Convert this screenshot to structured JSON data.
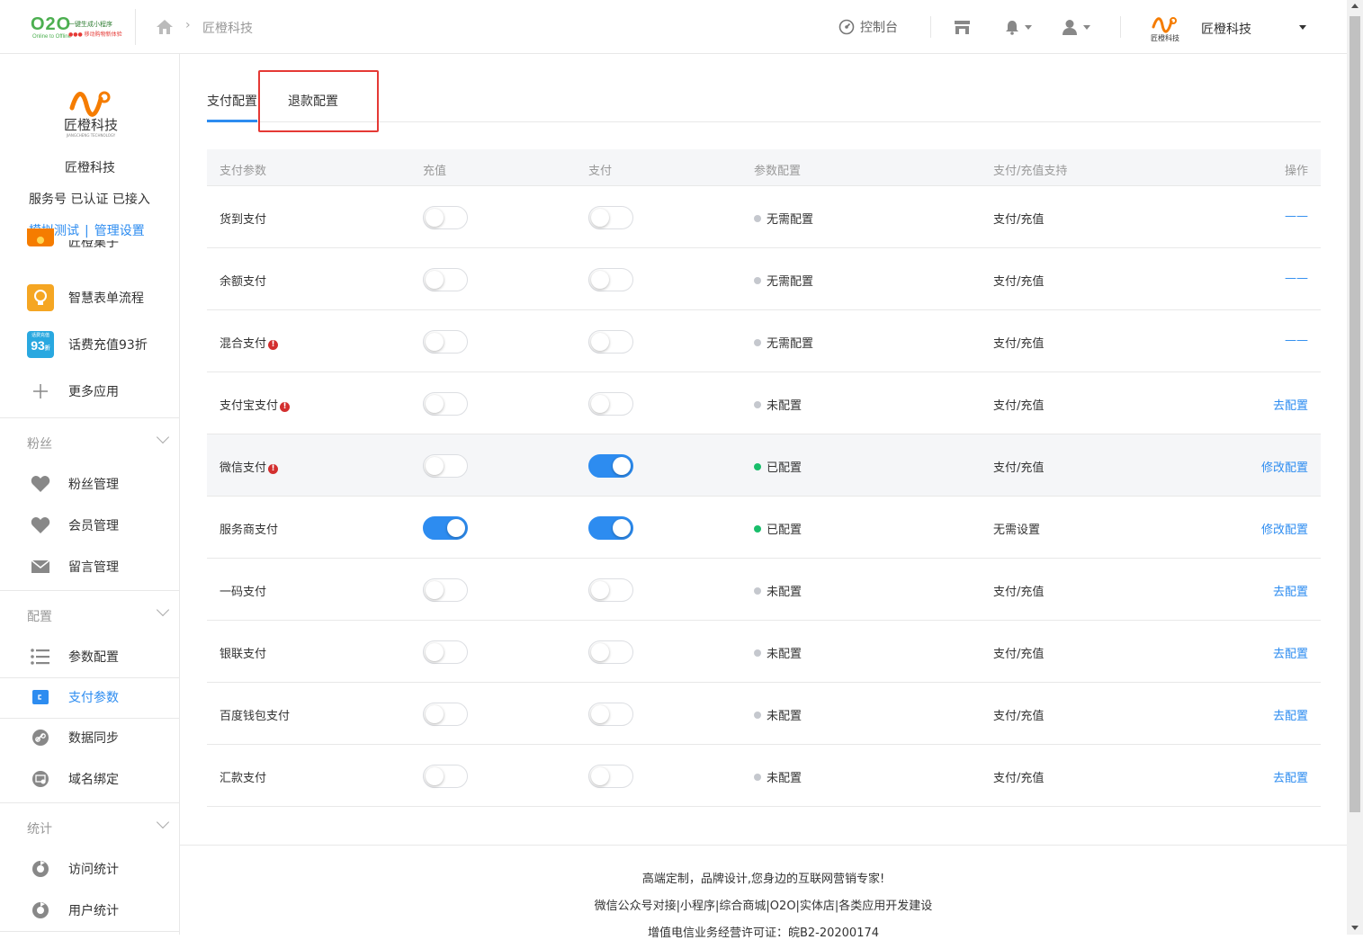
{
  "topbar": {
    "logo_main": "O2O",
    "logo_sub": "Online to Offline",
    "logo_slogan": "一键生成小程序",
    "logo_slogan2": "●●● 移动购物新体验",
    "breadcrumb": "匠橙科技",
    "console": "控制台",
    "brand_name": "匠橙科技"
  },
  "sidebar": {
    "logo_text": "匠橙科技",
    "logo_sub": "JIANGCHENG TECHNOLOGY",
    "company": "匠橙科技",
    "status": "服务号 已认证 已接入",
    "link_test": "模拟测试",
    "link_sep": "|",
    "link_manage": "管理设置",
    "apps": [
      {
        "label": "匠橙集子"
      },
      {
        "label": "智慧表单流程"
      },
      {
        "label": "话费充值93折",
        "badge": "93",
        "badge_top": "话费充值",
        "badge_suffix": "折"
      },
      {
        "label": "更多应用"
      }
    ],
    "sections": {
      "fans": {
        "title": "粉丝",
        "items": [
          {
            "label": "粉丝管理"
          },
          {
            "label": "会员管理"
          },
          {
            "label": "留言管理"
          }
        ]
      },
      "config": {
        "title": "配置",
        "items": [
          {
            "label": "参数配置"
          },
          {
            "label": "支付参数"
          },
          {
            "label": "数据同步"
          },
          {
            "label": "域名绑定"
          }
        ]
      },
      "stats": {
        "title": "统计",
        "items": [
          {
            "label": "访问统计"
          },
          {
            "label": "用户统计"
          }
        ]
      }
    }
  },
  "tabs": [
    {
      "label": "支付配置"
    },
    {
      "label": "退款配置"
    }
  ],
  "table": {
    "headers": [
      "支付参数",
      "充值",
      "支付",
      "参数配置",
      "支付/充值支持",
      "操作"
    ],
    "rows": [
      {
        "name": "货到支付",
        "warn": false,
        "recharge": false,
        "pay": false,
        "status": "无需配置",
        "configured": false,
        "support": "支付/充值",
        "op": "——"
      },
      {
        "name": "余额支付",
        "warn": false,
        "recharge": false,
        "pay": false,
        "status": "无需配置",
        "configured": false,
        "support": "支付/充值",
        "op": "——"
      },
      {
        "name": "混合支付",
        "warn": true,
        "recharge": false,
        "pay": false,
        "status": "无需配置",
        "configured": false,
        "support": "支付/充值",
        "op": "——"
      },
      {
        "name": "支付宝支付",
        "warn": true,
        "recharge": false,
        "pay": false,
        "status": "未配置",
        "configured": false,
        "support": "支付/充值",
        "op": "去配置"
      },
      {
        "name": "微信支付",
        "warn": true,
        "recharge": false,
        "pay": true,
        "status": "已配置",
        "configured": true,
        "support": "支付/充值",
        "op": "修改配置"
      },
      {
        "name": "服务商支付",
        "warn": false,
        "recharge": true,
        "pay": true,
        "status": "已配置",
        "configured": true,
        "support": "无需设置",
        "op": "修改配置"
      },
      {
        "name": "一码支付",
        "warn": false,
        "recharge": false,
        "pay": false,
        "status": "未配置",
        "configured": false,
        "support": "支付/充值",
        "op": "去配置"
      },
      {
        "name": "银联支付",
        "warn": false,
        "recharge": false,
        "pay": false,
        "status": "未配置",
        "configured": false,
        "support": "支付/充值",
        "op": "去配置"
      },
      {
        "name": "百度钱包支付",
        "warn": false,
        "recharge": false,
        "pay": false,
        "status": "未配置",
        "configured": false,
        "support": "支付/充值",
        "op": "去配置"
      },
      {
        "name": "汇款支付",
        "warn": false,
        "recharge": false,
        "pay": false,
        "status": "未配置",
        "configured": false,
        "support": "支付/充值",
        "op": "去配置"
      }
    ]
  },
  "footer": {
    "line1": "高端定制，品牌设计,您身边的互联网营销专家!",
    "line2": "微信公众号对接|小程序|综合商城|O2O|实体店|各类应用开发建设",
    "line3": "增值电信业务经营许可证：皖B2-20200174"
  },
  "colors": {
    "accent": "#2d8cf0",
    "ok": "#19be6b",
    "warn": "#d32f2f",
    "highlight_box": "#e53935"
  }
}
